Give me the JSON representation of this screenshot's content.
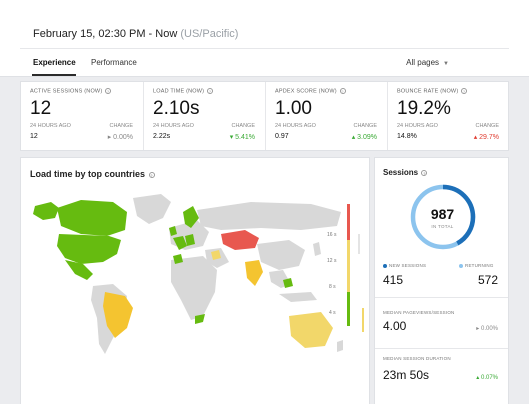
{
  "header": {
    "datetime": "February 15, 02:30 PM - Now",
    "timezone": "(US/Pacific)",
    "tabs": [
      {
        "label": "Experience",
        "active": true
      },
      {
        "label": "Performance",
        "active": false
      }
    ],
    "filter_label": "All pages"
  },
  "metrics": [
    {
      "title": "ACTIVE SESSIONS (NOW)",
      "value": "12",
      "ago_label": "24 HOURS AGO",
      "ago_value": "12",
      "change_label": "CHANGE",
      "change": "▸ 0.00%",
      "trend": "neutral"
    },
    {
      "title": "LOAD TIME (NOW)",
      "value": "2.10s",
      "ago_label": "24 HOURS AGO",
      "ago_value": "2.22s",
      "change_label": "CHANGE",
      "change": "▾ 5.41%",
      "trend": "up"
    },
    {
      "title": "APDEX SCORE (NOW)",
      "value": "1.00",
      "ago_label": "24 HOURS AGO",
      "ago_value": "0.97",
      "change_label": "CHANGE",
      "change": "▴ 3.09%",
      "trend": "up"
    },
    {
      "title": "BOUNCE RATE (NOW)",
      "value": "19.2%",
      "ago_label": "24 HOURS AGO",
      "ago_value": "14.8%",
      "change_label": "CHANGE",
      "change": "▴ 29.7%",
      "trend": "bad"
    }
  ],
  "map_card": {
    "title": "Load time by top countries",
    "legend_ticks": [
      "16 s",
      "12 s",
      "8 s",
      "4 s"
    ],
    "colors": {
      "fast": "#66bb10",
      "medium": "#f4c430",
      "slow": "#f2d76a",
      "critical": "#e8584f",
      "none": "#d8d8d8"
    }
  },
  "sessions": {
    "title": "Sessions",
    "total": "987",
    "total_label": "IN TOTAL",
    "new_label": "NEW SESSIONS",
    "new_value": "415",
    "returning_label": "RETURNING",
    "returning_value": "572",
    "new_share": 0.42,
    "new_color": "#1d6fb8",
    "returning_color": "#8cc4ee",
    "stats": [
      {
        "title": "MEDIAN PAGEVIEWS/SESSION",
        "value": "4.00",
        "change": "▸ 0.00%",
        "trend": "neutral"
      },
      {
        "title": "MEDIAN SESSION DURATION",
        "value": "23m 50s",
        "change": "▴ 0.07%",
        "trend": "up"
      }
    ]
  }
}
